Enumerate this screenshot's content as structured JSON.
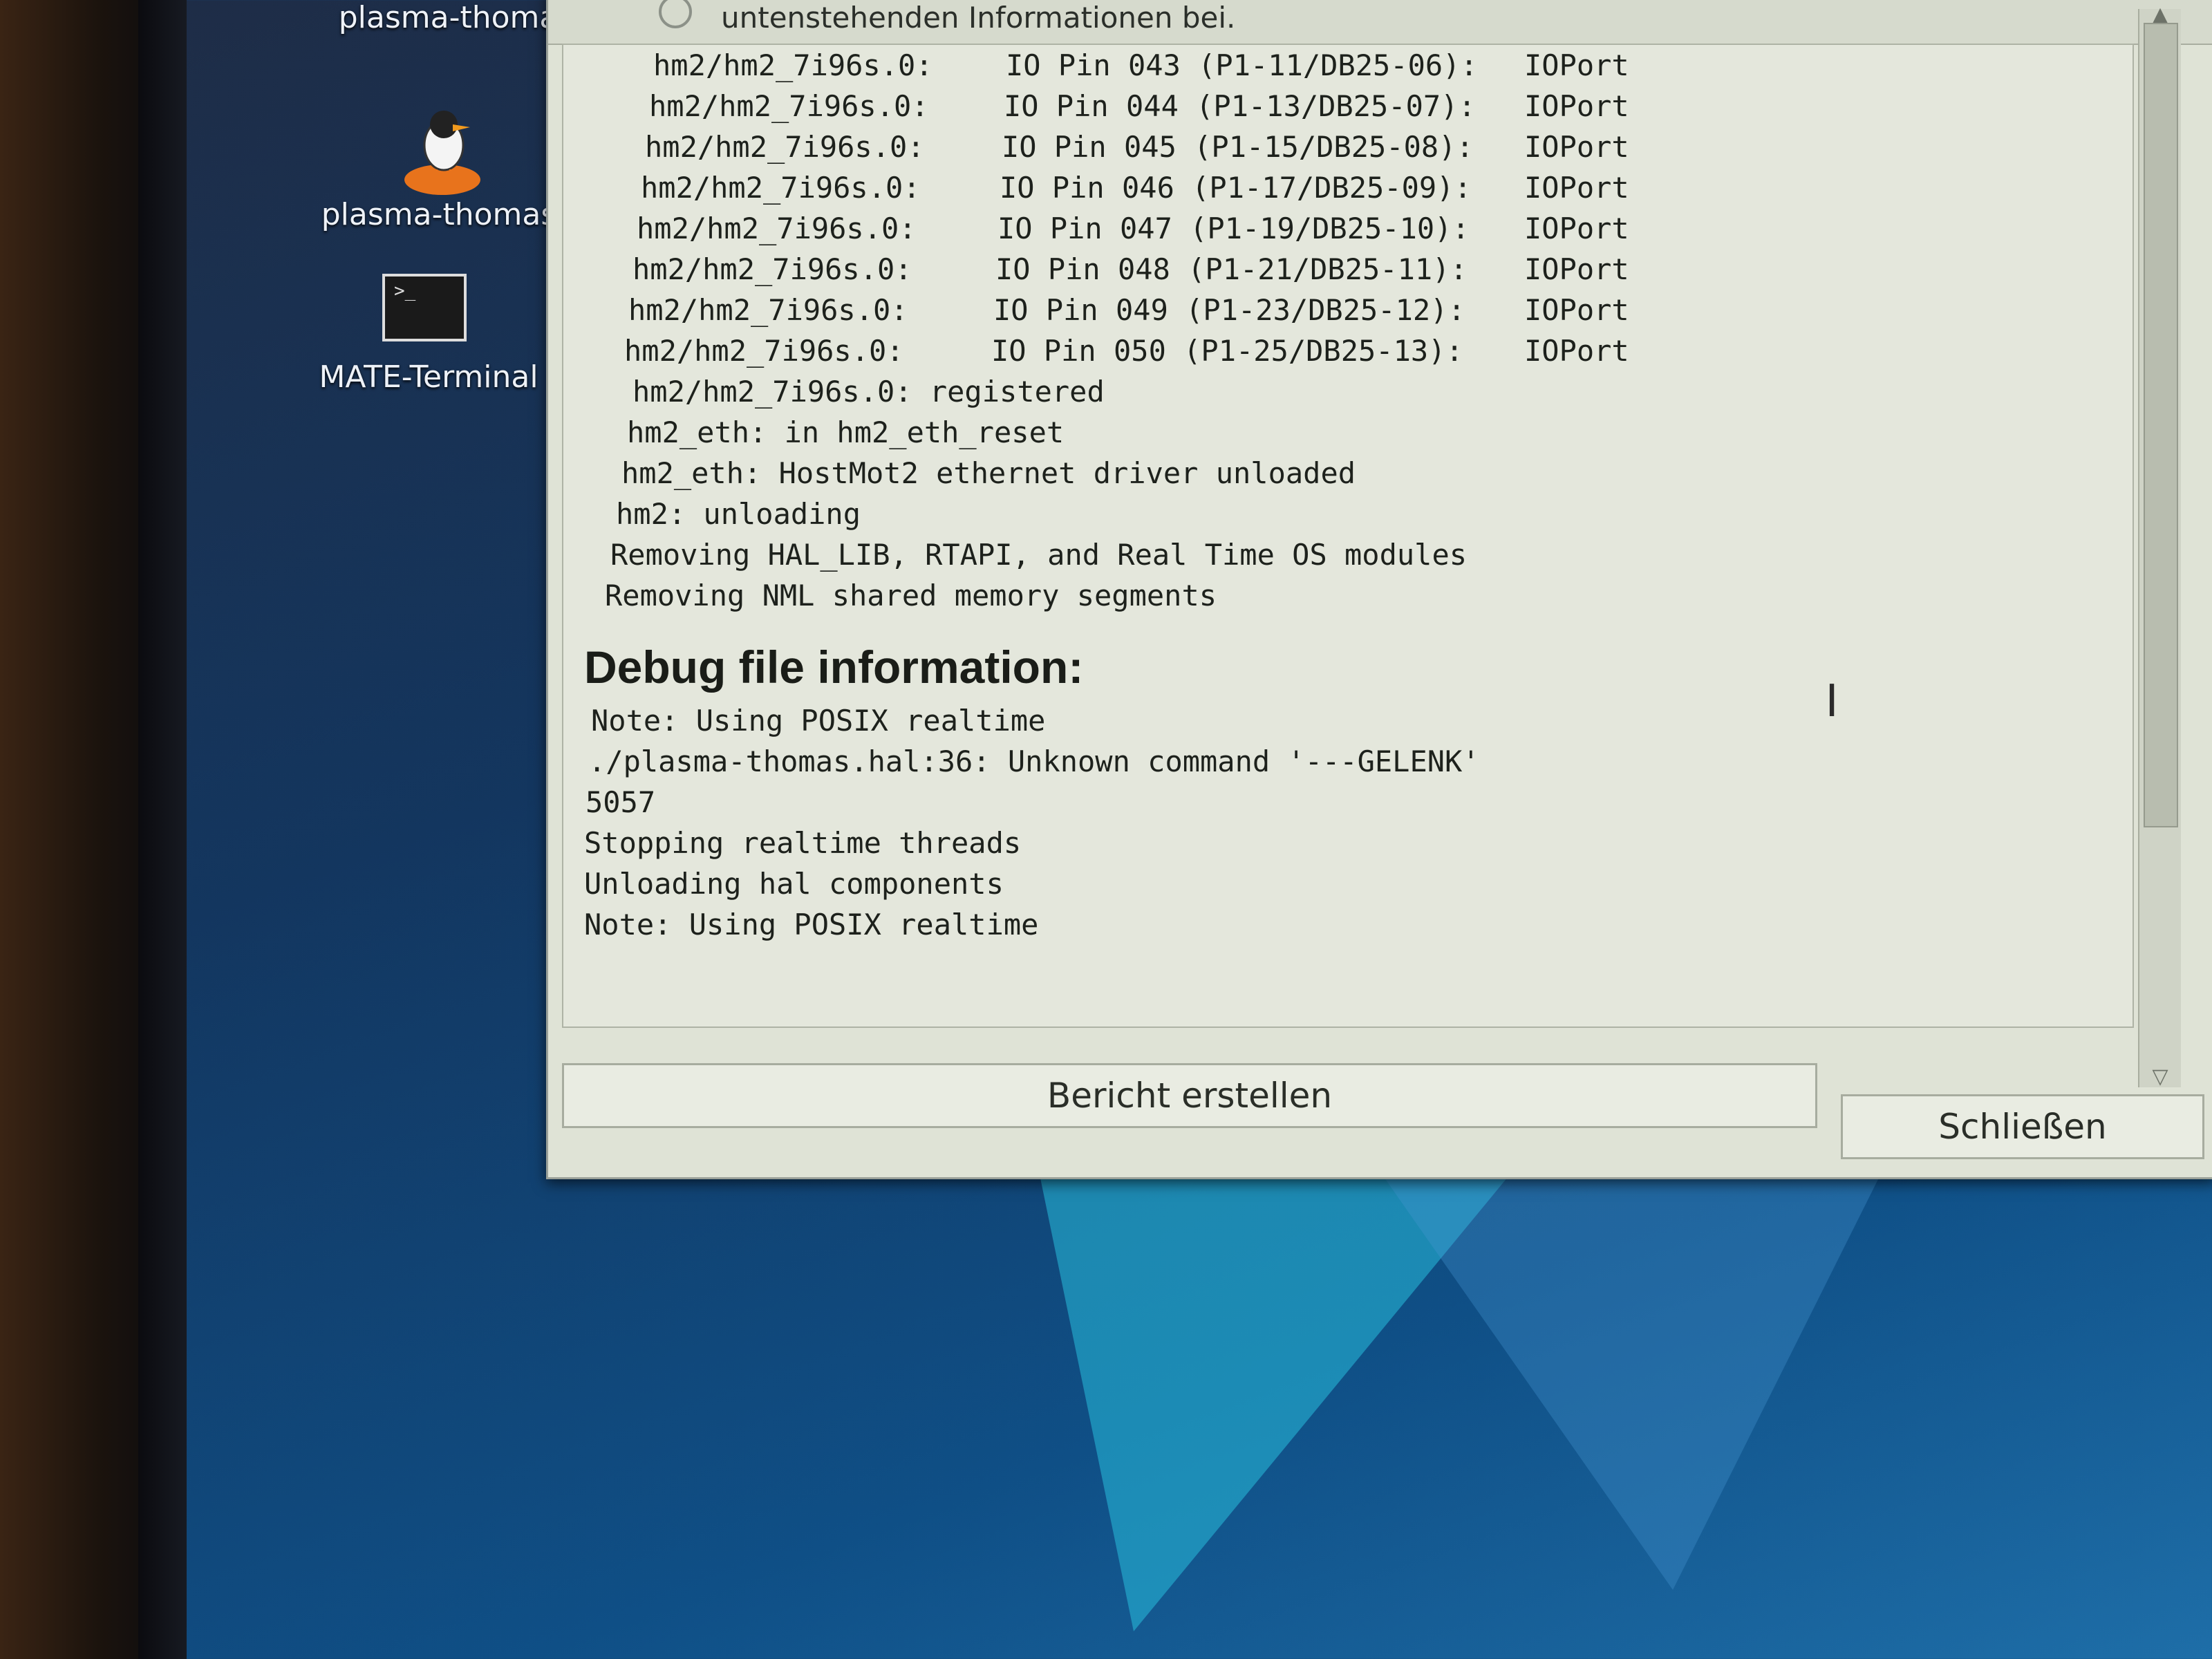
{
  "desktop": {
    "icons": [
      {
        "label": "plasma-thomas",
        "icon": "linuxcnc-penguin-icon"
      },
      {
        "label": "plasma-thomas",
        "icon": "linuxcnc-penguin-icon"
      },
      {
        "label": "MATE-Terminal",
        "icon": "terminal-icon"
      }
    ]
  },
  "dialog": {
    "header_text": "untenstehenden Informationen bei.",
    "pin_lines": [
      {
        "module": "hm2/hm2_7i96s.0:",
        "pin": "IO Pin 043 (P1-11/DB25-06):",
        "type": "IOPort"
      },
      {
        "module": "hm2/hm2_7i96s.0:",
        "pin": "IO Pin 044 (P1-13/DB25-07):",
        "type": "IOPort"
      },
      {
        "module": "hm2/hm2_7i96s.0:",
        "pin": "IO Pin 045 (P1-15/DB25-08):",
        "type": "IOPort"
      },
      {
        "module": "hm2/hm2_7i96s.0:",
        "pin": "IO Pin 046 (P1-17/DB25-09):",
        "type": "IOPort"
      },
      {
        "module": "hm2/hm2_7i96s.0:",
        "pin": "IO Pin 047 (P1-19/DB25-10):",
        "type": "IOPort"
      },
      {
        "module": "hm2/hm2_7i96s.0:",
        "pin": "IO Pin 048 (P1-21/DB25-11):",
        "type": "IOPort"
      },
      {
        "module": "hm2/hm2_7i96s.0:",
        "pin": "IO Pin 049 (P1-23/DB25-12):",
        "type": "IOPort"
      },
      {
        "module": "hm2/hm2_7i96s.0:",
        "pin": "IO Pin 050 (P1-25/DB25-13):",
        "type": "IOPort"
      }
    ],
    "log_lines": [
      "hm2/hm2_7i96s.0: registered",
      "hm2_eth: in hm2_eth_reset",
      "hm2_eth: HostMot2 ethernet driver unloaded",
      "hm2: unloading",
      "Removing HAL_LIB, RTAPI, and Real Time OS modules",
      "Removing NML shared memory segments"
    ],
    "debug_heading": "Debug file information:",
    "debug_lines": [
      "Note: Using POSIX realtime",
      "./plasma-thomas.hal:36: Unknown command '---GELENK'",
      "5057",
      "Stopping realtime threads",
      "Unloading hal components",
      "Note: Using POSIX realtime"
    ],
    "buttons": {
      "report": "Bericht erstellen",
      "close": "Schließen"
    }
  }
}
